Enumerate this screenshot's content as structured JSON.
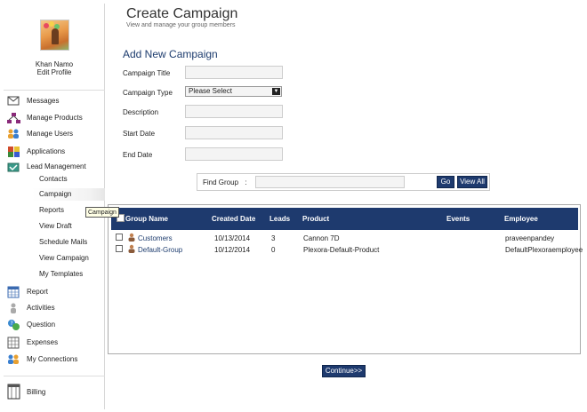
{
  "profile": {
    "name": "Khan Namo",
    "edit_link": "Edit Profile"
  },
  "nav": {
    "messages": "Messages",
    "manage_products": "Manage Products",
    "manage_users": "Manage Users",
    "applications": "Applications",
    "lead_management": "Lead Management",
    "lead_sub": [
      "Contacts",
      "Campaign",
      "Reports",
      "View Draft",
      "Schedule Mails",
      "View Campaign",
      "My Templates"
    ],
    "report": "Report",
    "activities": "Activities",
    "question": "Question",
    "expenses": "Expenses",
    "my_connections": "My Connections",
    "billing": "Billing"
  },
  "tooltip": "Campaign",
  "page": {
    "title": "Create Campaign",
    "subtitle": "View and manage your group members"
  },
  "form": {
    "title": "Add New Campaign",
    "campaign_title_label": "Campaign Title",
    "campaign_type_label": "Campaign Type",
    "campaign_type_value": "Please Select",
    "description_label": "Description",
    "start_date_label": "Start Date",
    "end_date_label": "End Date"
  },
  "find": {
    "label": "Find Group",
    "colon": ":",
    "go": "Go",
    "view_all": "View All"
  },
  "table": {
    "headers": {
      "name": "Group Name",
      "created": "Created Date",
      "leads": "Leads",
      "product": "Product",
      "events": "Events",
      "employee": "Employee"
    },
    "rows": [
      {
        "name": "Customers",
        "created": "10/13/2014",
        "leads": "3",
        "product": "Cannon 7D",
        "events": "",
        "employee": "praveenpandey"
      },
      {
        "name": "Default-Group",
        "created": "10/12/2014",
        "leads": "0",
        "product": "Plexora-Default-Product",
        "events": "",
        "employee": "DefaultPlexoraemployee"
      }
    ]
  },
  "continue_label": "Continue>>",
  "colors": {
    "accent": "#1e3a6e",
    "link": "#1d3c6e"
  }
}
